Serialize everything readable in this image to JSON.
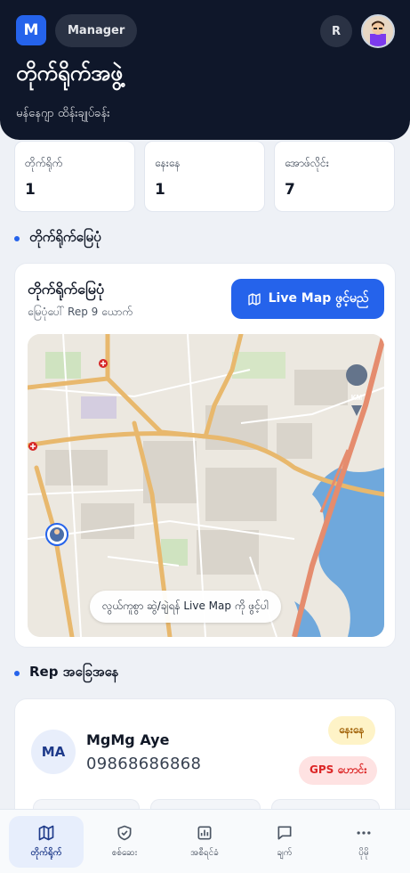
{
  "header": {
    "logo_letter": "M",
    "role": "Manager",
    "user_initial": "R",
    "title": "တိုက်ရိုက်အဖွဲ့",
    "subtitle": "မန်နေဂျာ ထိန်းချုပ်ခန်း"
  },
  "stats": [
    {
      "label": "တိုက်ရိုက်",
      "value": "1"
    },
    {
      "label": "နေးနေ",
      "value": "1"
    },
    {
      "label": "အောဖ်လိုင်း",
      "value": "7"
    }
  ],
  "map_section": {
    "heading": "တိုက်ရိုက်မြေပုံ",
    "card_title": "တိုက်ရိုက်မြေပုံ",
    "card_subtitle": "မြေပုံပေါ် Rep 9 ယောက်",
    "live_button": "Live Map ဖွင့်မည်",
    "hint": "လွယ်ကူစွာ ဆွဲ/ချဲရန် Live Map ကို ဖွင့်ပါ",
    "marker_label": "KM"
  },
  "rep_section": {
    "heading": "Rep အခြေအနေ",
    "rep": {
      "initials": "MA",
      "name": "MgMg Aye",
      "phone": "09868686868",
      "status": "နေးနေ",
      "gps": "GPS ဟောင်း"
    }
  },
  "nav": [
    {
      "label": "တိုက်ရိုက်",
      "icon": "map-icon",
      "active": true
    },
    {
      "label": "စစ်ဆေး",
      "icon": "shield-check-icon",
      "active": false
    },
    {
      "label": "အစီရင်ခံ",
      "icon": "chart-icon",
      "active": false
    },
    {
      "label": "ချက်",
      "icon": "chat-icon",
      "active": false
    },
    {
      "label": "ပိုမို",
      "icon": "more-icon",
      "active": false
    }
  ],
  "colors": {
    "primary": "#2563eb",
    "header_bg": "#0f172a",
    "page_bg": "#eef1f6",
    "warning_bg": "#fef3c7",
    "danger_bg": "#fee2e2"
  }
}
